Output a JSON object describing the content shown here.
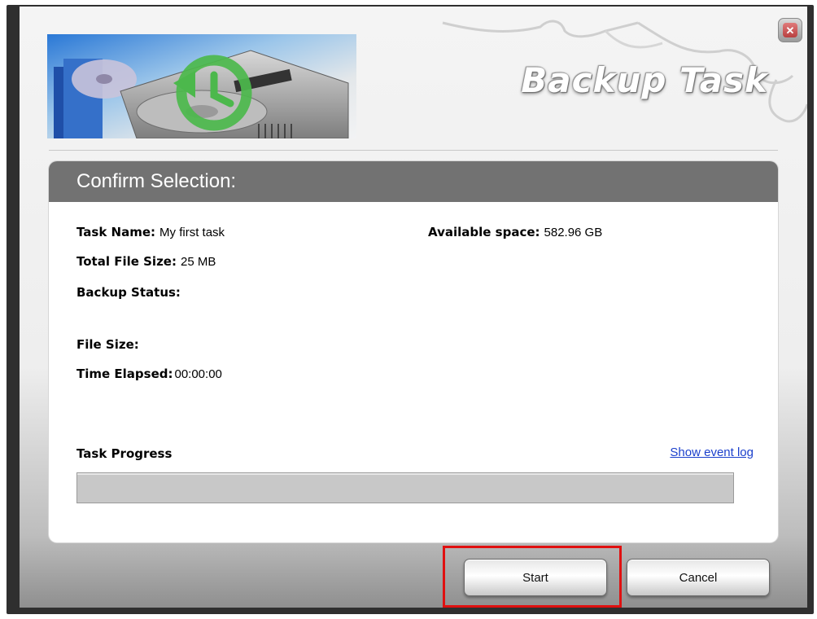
{
  "window": {
    "title": "Backup Task",
    "close_icon": "close-icon"
  },
  "panel": {
    "header": "Confirm Selection:"
  },
  "details": {
    "task_name_label": "Task Name:",
    "task_name_value": "My first task",
    "total_size_label": "Total File Size:",
    "total_size_value": "25 MB",
    "backup_status_label": "Backup Status:",
    "backup_status_value": "",
    "file_size_label": "File Size:",
    "file_size_value": "",
    "time_elapsed_label": "Time Elapsed:",
    "time_elapsed_value": "00:00:00",
    "available_space_label": "Available space:",
    "available_space_value": "582.96 GB"
  },
  "progress": {
    "label": "Task Progress",
    "link": "Show event log",
    "fraction": 0
  },
  "buttons": {
    "start": "Start",
    "cancel": "Cancel"
  },
  "colors": {
    "header_bg": "#727272",
    "highlight": "#e01010",
    "link": "#1a3fcc"
  }
}
